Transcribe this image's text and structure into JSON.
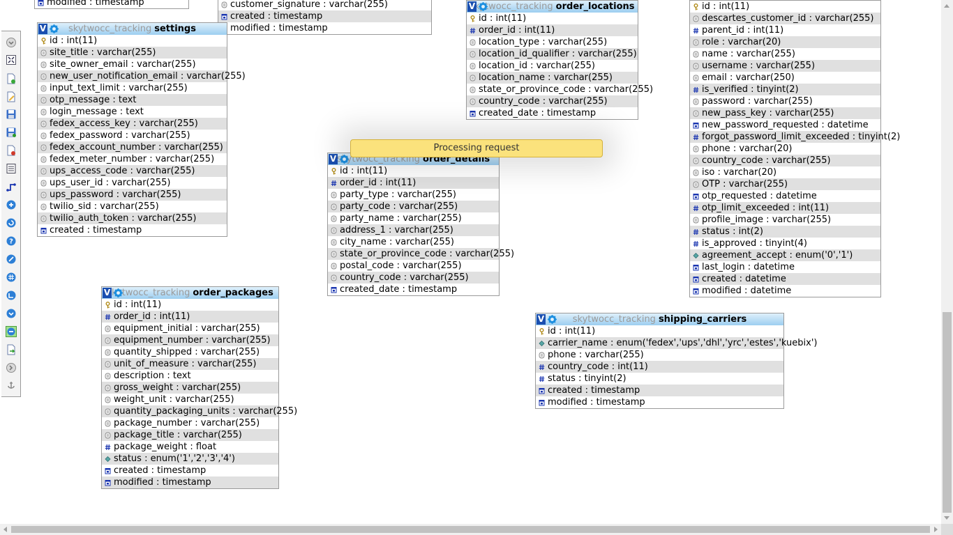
{
  "notification": {
    "text": "Processing request"
  },
  "toolbar": {
    "buttons": [
      {
        "name": "toggle-menu-icon"
      },
      {
        "name": "fit-to-screen-icon"
      },
      {
        "name": "new-page-icon"
      },
      {
        "name": "edit-page-icon"
      },
      {
        "name": "save-icon"
      },
      {
        "name": "save-as-icon"
      },
      {
        "name": "delete-page-icon"
      },
      {
        "name": "table-list-icon"
      },
      {
        "name": "relation-lines-icon"
      },
      {
        "name": "show-columns-icon"
      },
      {
        "name": "refresh-icon"
      },
      {
        "name": "help-icon"
      },
      {
        "name": "toggle-direct-links-icon"
      },
      {
        "name": "grid-icon"
      },
      {
        "name": "angular-links-icon"
      },
      {
        "name": "small-big-icon"
      },
      {
        "name": "toggle-keys-icon"
      },
      {
        "name": "export-icon"
      },
      {
        "name": "move-menu-icon"
      },
      {
        "name": "pin-icon"
      }
    ]
  },
  "tables": [
    {
      "key": "partial_top_left",
      "db": "",
      "name": "",
      "rows": [
        {
          "icon": "timestamp",
          "text": "modified : timestamp"
        }
      ]
    },
    {
      "key": "partial_top_middle",
      "db": "",
      "name": "",
      "rows": [
        {
          "icon": "text",
          "text": "customer_signature : varchar(255)"
        },
        {
          "icon": "timestamp",
          "text": "created : timestamp"
        },
        {
          "icon": "timestamp",
          "text": "modified : timestamp"
        }
      ]
    },
    {
      "key": "settings",
      "db": "skytwocc_tracking",
      "name": "settings",
      "rows": [
        {
          "icon": "key",
          "text": "id : int(11)"
        },
        {
          "icon": "text",
          "text": "site_title : varchar(255)"
        },
        {
          "icon": "text",
          "text": "site_owner_email : varchar(255)"
        },
        {
          "icon": "text",
          "text": "new_user_notification_email : varchar(255)"
        },
        {
          "icon": "text",
          "text": "input_text_limit : varchar(255)"
        },
        {
          "icon": "text",
          "text": "otp_message : text"
        },
        {
          "icon": "text",
          "text": "login_message : text"
        },
        {
          "icon": "text",
          "text": "fedex_access_key : varchar(255)"
        },
        {
          "icon": "text",
          "text": "fedex_password : varchar(255)"
        },
        {
          "icon": "text",
          "text": "fedex_account_number : varchar(255)"
        },
        {
          "icon": "text",
          "text": "fedex_meter_number : varchar(255)"
        },
        {
          "icon": "text",
          "text": "ups_access_code : varchar(255)"
        },
        {
          "icon": "text",
          "text": "ups_user_id : varchar(255)"
        },
        {
          "icon": "text",
          "text": "ups_password : varchar(255)"
        },
        {
          "icon": "text",
          "text": "twilio_sid : varchar(255)"
        },
        {
          "icon": "text",
          "text": "twilio_auth_token : varchar(255)"
        },
        {
          "icon": "timestamp",
          "text": "created : timestamp"
        }
      ]
    },
    {
      "key": "order_locations",
      "db": "skytwocc_tracking",
      "name": "order_locations",
      "rows": [
        {
          "icon": "key",
          "text": "id : int(11)"
        },
        {
          "icon": "number",
          "text": "order_id : int(11)"
        },
        {
          "icon": "text",
          "text": "location_type : varchar(255)"
        },
        {
          "icon": "text",
          "text": "location_id_qualifier : varchar(255)"
        },
        {
          "icon": "text",
          "text": "location_id : varchar(255)"
        },
        {
          "icon": "text",
          "text": "location_name : varchar(255)"
        },
        {
          "icon": "text",
          "text": "state_or_province_code : varchar(255)"
        },
        {
          "icon": "text",
          "text": "country_code : varchar(255)"
        },
        {
          "icon": "timestamp",
          "text": "created_date : timestamp"
        }
      ]
    },
    {
      "key": "users_partial",
      "db": "",
      "name": "",
      "rows": [
        {
          "icon": "key",
          "text": "id : int(11)"
        },
        {
          "icon": "text",
          "text": "descartes_customer_id : varchar(255)"
        },
        {
          "icon": "number",
          "text": "parent_id : int(11)"
        },
        {
          "icon": "text",
          "text": "role : varchar(20)"
        },
        {
          "icon": "text",
          "text": "name : varchar(255)"
        },
        {
          "icon": "text",
          "text": "username : varchar(255)"
        },
        {
          "icon": "text",
          "text": "email : varchar(250)"
        },
        {
          "icon": "number",
          "text": "is_verified : tinyint(2)"
        },
        {
          "icon": "text",
          "text": "password : varchar(255)"
        },
        {
          "icon": "text",
          "text": "new_pass_key : varchar(255)"
        },
        {
          "icon": "timestamp",
          "text": "new_password_requested : datetime"
        },
        {
          "icon": "number",
          "text": "forgot_password_limit_exceeded : tinyint(2)"
        },
        {
          "icon": "text",
          "text": "phone : varchar(20)"
        },
        {
          "icon": "text",
          "text": "country_code : varchar(255)"
        },
        {
          "icon": "text",
          "text": "iso : varchar(20)"
        },
        {
          "icon": "text",
          "text": "OTP : varchar(255)"
        },
        {
          "icon": "timestamp",
          "text": "otp_requested : datetime"
        },
        {
          "icon": "number",
          "text": "otp_limit_exceeded : int(11)"
        },
        {
          "icon": "text",
          "text": "profile_image : varchar(255)"
        },
        {
          "icon": "number",
          "text": "status : int(2)"
        },
        {
          "icon": "number",
          "text": "is_approved : tinyint(4)"
        },
        {
          "icon": "enum",
          "text": "agreement_accept : enum('0','1')"
        },
        {
          "icon": "timestamp",
          "text": "last_login : datetime"
        },
        {
          "icon": "timestamp",
          "text": "created : datetime"
        },
        {
          "icon": "timestamp",
          "text": "modified : datetime"
        }
      ]
    },
    {
      "key": "order_details",
      "db": "skytwocc_tracking",
      "name": "order_details",
      "rows": [
        {
          "icon": "key",
          "text": "id : int(11)"
        },
        {
          "icon": "number",
          "text": "order_id : int(11)"
        },
        {
          "icon": "text",
          "text": "party_type : varchar(255)"
        },
        {
          "icon": "text",
          "text": "party_code : varchar(255)"
        },
        {
          "icon": "text",
          "text": "party_name : varchar(255)"
        },
        {
          "icon": "text",
          "text": "address_1 : varchar(255)"
        },
        {
          "icon": "text",
          "text": "city_name : varchar(255)"
        },
        {
          "icon": "text",
          "text": "state_or_province_code : varchar(255)"
        },
        {
          "icon": "text",
          "text": "postal_code : varchar(255)"
        },
        {
          "icon": "text",
          "text": "country_code : varchar(255)"
        },
        {
          "icon": "timestamp",
          "text": "created_date : timestamp"
        }
      ]
    },
    {
      "key": "order_packages",
      "db": "skytwocc_tracking",
      "name": "order_packages",
      "rows": [
        {
          "icon": "key",
          "text": "id : int(11)"
        },
        {
          "icon": "number",
          "text": "order_id : int(11)"
        },
        {
          "icon": "text",
          "text": "equipment_initial : varchar(255)"
        },
        {
          "icon": "text",
          "text": "equipment_number : varchar(255)"
        },
        {
          "icon": "text",
          "text": "quantity_shipped : varchar(255)"
        },
        {
          "icon": "text",
          "text": "unit_of_measure : varchar(255)"
        },
        {
          "icon": "text",
          "text": "description : text"
        },
        {
          "icon": "text",
          "text": "gross_weight : varchar(255)"
        },
        {
          "icon": "text",
          "text": "weight_unit : varchar(255)"
        },
        {
          "icon": "text",
          "text": "quantity_packaging_units : varchar(255)"
        },
        {
          "icon": "text",
          "text": "package_number : varchar(255)"
        },
        {
          "icon": "text",
          "text": "package_title : varchar(255)"
        },
        {
          "icon": "number",
          "text": "package_weight : float"
        },
        {
          "icon": "enum",
          "text": "status : enum('1','2','3','4')"
        },
        {
          "icon": "timestamp",
          "text": "created : timestamp"
        },
        {
          "icon": "timestamp",
          "text": "modified : timestamp"
        }
      ]
    },
    {
      "key": "shipping_carriers",
      "db": "skytwocc_tracking",
      "name": "shipping_carriers",
      "rows": [
        {
          "icon": "key",
          "text": "id : int(11)"
        },
        {
          "icon": "enum",
          "text": "carrier_name : enum('fedex','ups','dhl','yrc','estes','kuebix')"
        },
        {
          "icon": "text",
          "text": "phone : varchar(255)"
        },
        {
          "icon": "number",
          "text": "country_code : int(11)"
        },
        {
          "icon": "number",
          "text": "status : tinyint(2)"
        },
        {
          "icon": "timestamp",
          "text": "created : timestamp"
        },
        {
          "icon": "timestamp",
          "text": "modified : timestamp"
        }
      ]
    }
  ],
  "header_labels": {
    "v": "V"
  }
}
